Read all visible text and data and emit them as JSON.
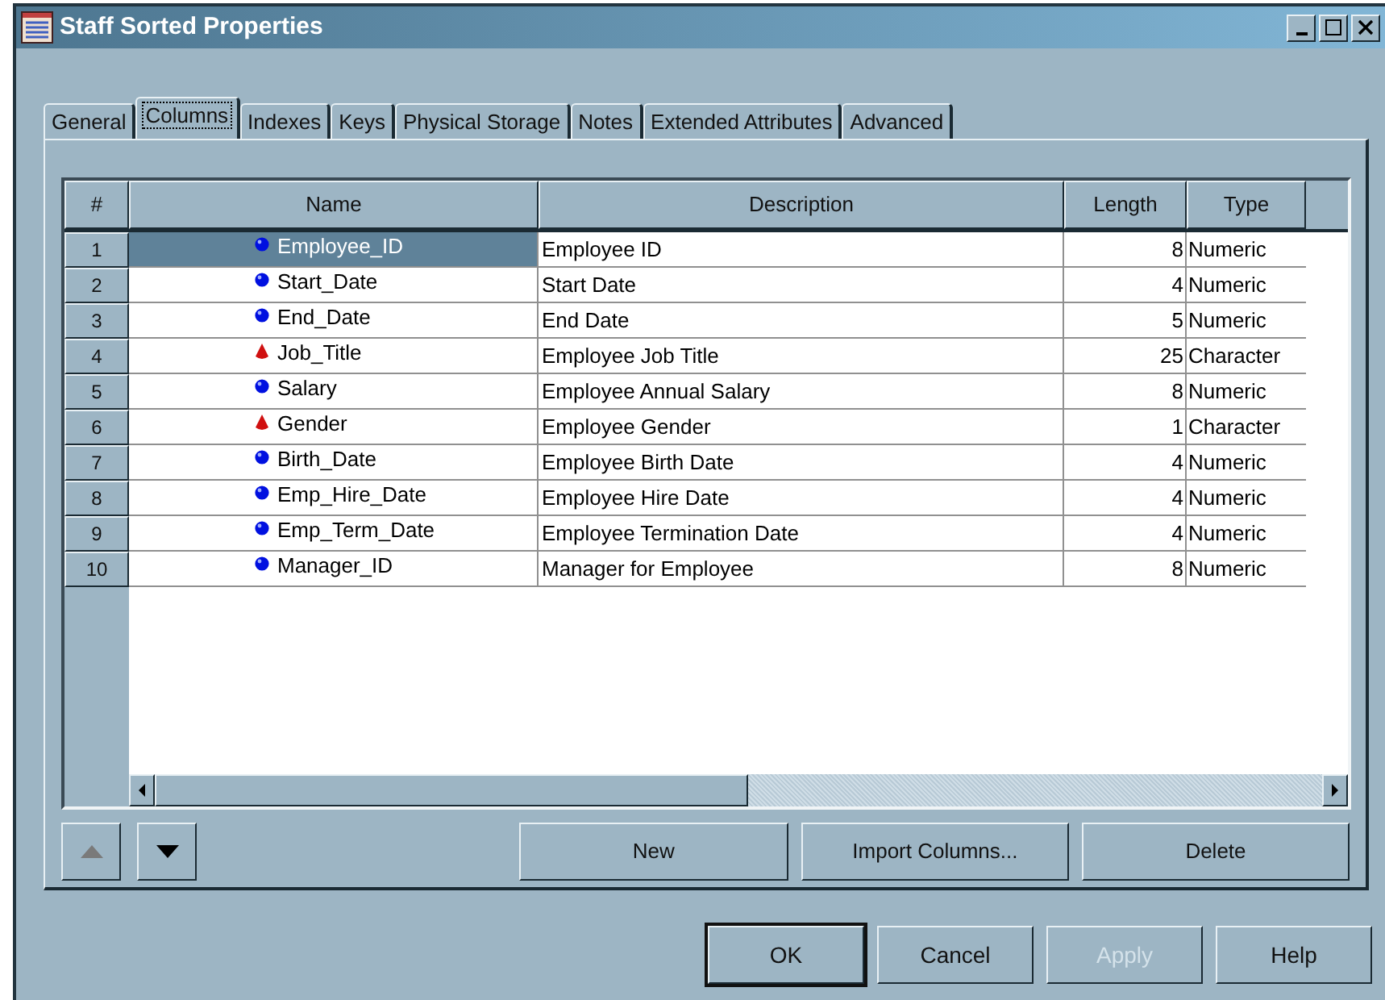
{
  "window": {
    "title": "Staff Sorted Properties"
  },
  "tabs": [
    {
      "label": "General",
      "selected": false
    },
    {
      "label": "Columns",
      "selected": true
    },
    {
      "label": "Indexes",
      "selected": false
    },
    {
      "label": "Keys",
      "selected": false
    },
    {
      "label": "Physical Storage",
      "selected": false
    },
    {
      "label": "Notes",
      "selected": false
    },
    {
      "label": "Extended Attributes",
      "selected": false
    },
    {
      "label": "Advanced",
      "selected": false
    }
  ],
  "table": {
    "columns": [
      "#",
      "Name",
      "Description",
      "Length",
      "Type"
    ],
    "rows": [
      {
        "number": "1",
        "kind": "numeric",
        "name": "Employee_ID",
        "description": "Employee ID",
        "length": "8",
        "type": "Numeric",
        "selected": true
      },
      {
        "number": "2",
        "kind": "numeric",
        "name": "Start_Date",
        "description": "Start Date",
        "length": "4",
        "type": "Numeric",
        "selected": false
      },
      {
        "number": "3",
        "kind": "numeric",
        "name": "End_Date",
        "description": "End Date",
        "length": "5",
        "type": "Numeric",
        "selected": false
      },
      {
        "number": "4",
        "kind": "character",
        "name": "Job_Title",
        "description": "Employee Job Title",
        "length": "25",
        "type": "Character",
        "selected": false
      },
      {
        "number": "5",
        "kind": "numeric",
        "name": "Salary",
        "description": "Employee Annual Salary",
        "length": "8",
        "type": "Numeric",
        "selected": false
      },
      {
        "number": "6",
        "kind": "character",
        "name": "Gender",
        "description": "Employee Gender",
        "length": "1",
        "type": "Character",
        "selected": false
      },
      {
        "number": "7",
        "kind": "numeric",
        "name": "Birth_Date",
        "description": "Employee Birth Date",
        "length": "4",
        "type": "Numeric",
        "selected": false
      },
      {
        "number": "8",
        "kind": "numeric",
        "name": "Emp_Hire_Date",
        "description": "Employee Hire Date",
        "length": "4",
        "type": "Numeric",
        "selected": false
      },
      {
        "number": "9",
        "kind": "numeric",
        "name": "Emp_Term_Date",
        "description": "Employee Termination Date",
        "length": "4",
        "type": "Numeric",
        "selected": false
      },
      {
        "number": "10",
        "kind": "numeric",
        "name": "Manager_ID",
        "description": "Manager for Employee",
        "length": "8",
        "type": "Numeric",
        "selected": false
      }
    ]
  },
  "move_buttons": [
    {
      "kind": "up",
      "disabled": true
    },
    {
      "kind": "down",
      "disabled": false
    }
  ],
  "column_buttons": [
    {
      "label": "New",
      "disabled": false
    },
    {
      "label": "Import Columns...",
      "disabled": false
    },
    {
      "label": "Delete",
      "disabled": false
    }
  ],
  "dialog_buttons": [
    {
      "label": "OK",
      "disabled": false,
      "default": true
    },
    {
      "label": "Cancel",
      "disabled": false,
      "default": false
    },
    {
      "label": "Apply",
      "disabled": true,
      "default": false
    },
    {
      "label": "Help",
      "disabled": false,
      "default": false
    }
  ]
}
